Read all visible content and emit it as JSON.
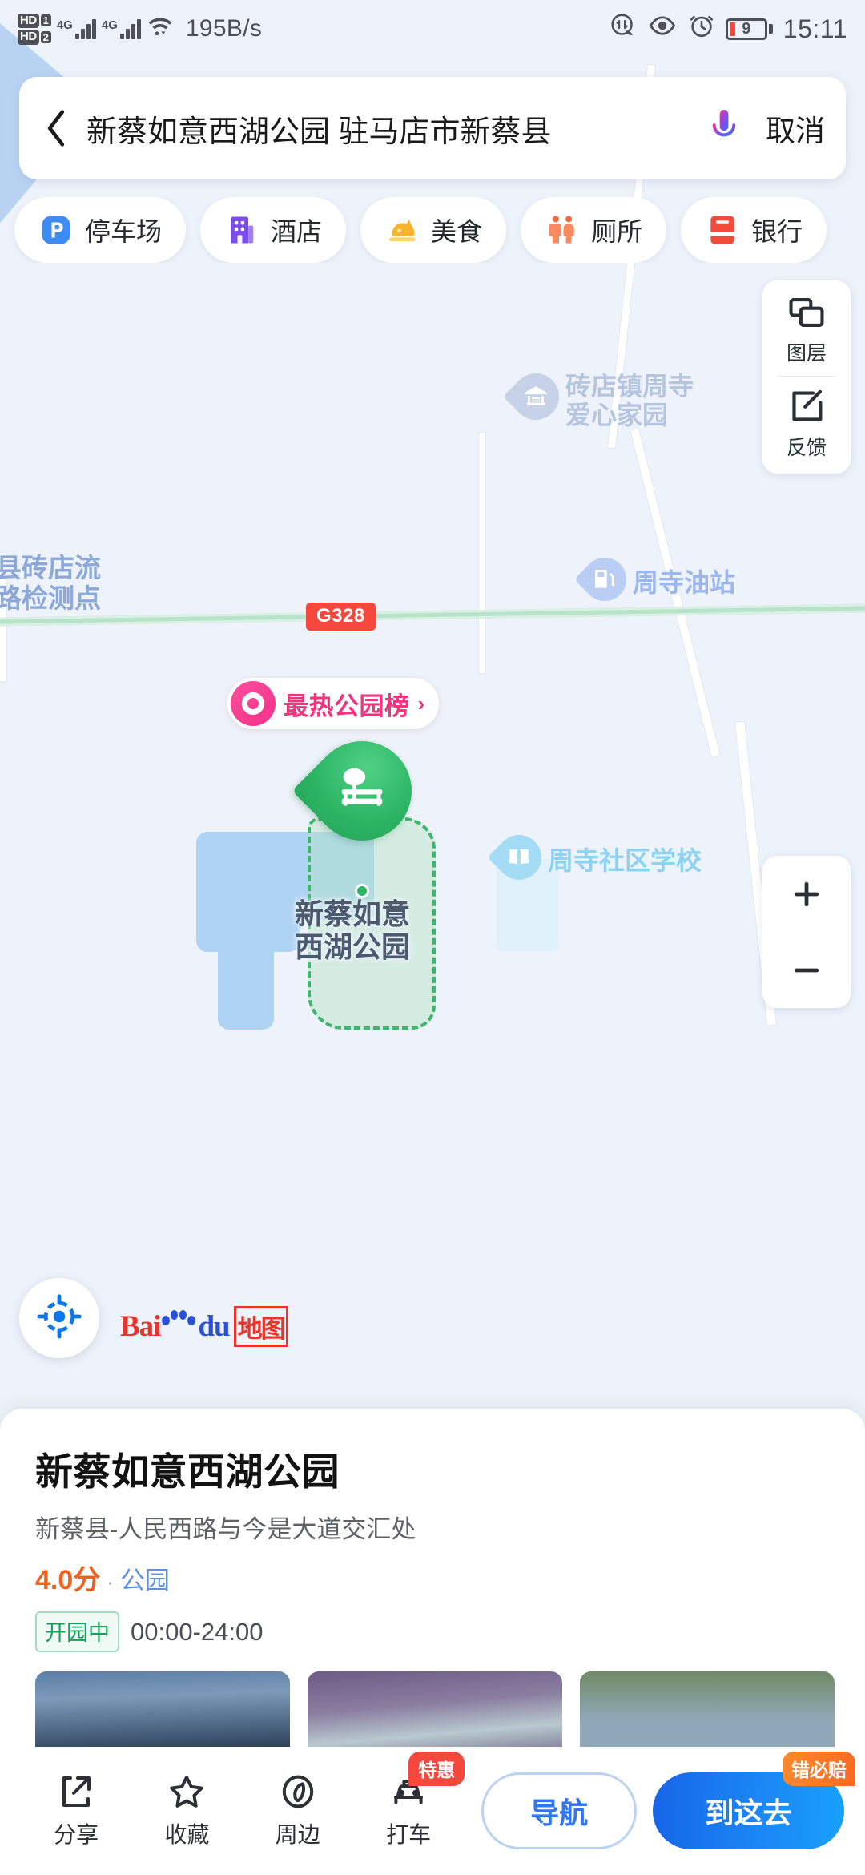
{
  "status_bar": {
    "hd1_label": "HD",
    "hd1_num": "1",
    "hd2_label": "HD",
    "hd2_num": "2",
    "net1": "4G",
    "net2": "4G",
    "net_speed": "195B/s",
    "battery_percent": "9",
    "time": "15:11",
    "icons": [
      "data-saver-icon",
      "eye-comfort-icon",
      "alarm-clock-icon",
      "battery-icon"
    ]
  },
  "search": {
    "back_icon": "back-chevron-icon",
    "query": "新蔡如意西湖公园 驻马店市新蔡县",
    "mic_icon": "microphone-icon",
    "cancel_label": "取消"
  },
  "chips": [
    {
      "label": "停车场",
      "icon": "parking-icon",
      "color": "#3d8cf5"
    },
    {
      "label": "酒店",
      "icon": "hotel-icon",
      "color": "#7b4df0"
    },
    {
      "label": "美食",
      "icon": "food-icon",
      "color": "#f7b42c"
    },
    {
      "label": "厕所",
      "icon": "toilet-icon",
      "color": "#f56a3c"
    },
    {
      "label": "银行",
      "icon": "bank-icon",
      "color": "#f24b3c"
    }
  ],
  "map_controls": {
    "layers_label": "图层",
    "layers_icon": "layers-icon",
    "feedback_label": "反馈",
    "feedback_icon": "edit-feedback-icon",
    "zoom_in": "+",
    "zoom_out": "−",
    "locate_icon": "locate-crosshair-icon"
  },
  "map": {
    "highway_shield": "G328",
    "hot_badge": {
      "text": "最热公园榜",
      "arrow": "›",
      "color": "#f4337f"
    },
    "main_marker": {
      "label": "新蔡如意\n西湖公园",
      "icon": "park-tree-bench-icon",
      "color": "#2cb463"
    },
    "pois": [
      {
        "name": "砖店镇周寺\n爱心家园",
        "icon": "community-building-icon"
      },
      {
        "name": "周寺油站",
        "icon": "gas-station-icon"
      },
      {
        "name": "周寺社区学校",
        "icon": "school-book-icon"
      }
    ],
    "plain_labels": [
      {
        "text": "县砖店流\n路检测点"
      }
    ],
    "logo": {
      "bai": "Bai",
      "du": "du",
      "cn": "地图"
    }
  },
  "info_card": {
    "title": "新蔡如意西湖公园",
    "address": "新蔡县-人民西路与今是大道交汇处",
    "rating": "4.0分",
    "separator": "·",
    "category": "公园",
    "open_status": "开园中",
    "hours": "00:00-24:00",
    "photos": [
      {
        "alt": "lakeside-sunset-photo"
      },
      {
        "alt": "monument-tower-photo"
      },
      {
        "alt": "willow-tree-lake-photo"
      }
    ]
  },
  "bottom_bar": {
    "items": [
      {
        "label": "分享",
        "icon": "share-icon",
        "badge": ""
      },
      {
        "label": "收藏",
        "icon": "star-icon",
        "badge": ""
      },
      {
        "label": "周边",
        "icon": "compass-icon",
        "badge": ""
      },
      {
        "label": "打车",
        "icon": "taxi-icon",
        "badge": "特惠"
      }
    ],
    "nav_label": "导航",
    "go_label": "到这去",
    "go_badge": "错必赔"
  }
}
